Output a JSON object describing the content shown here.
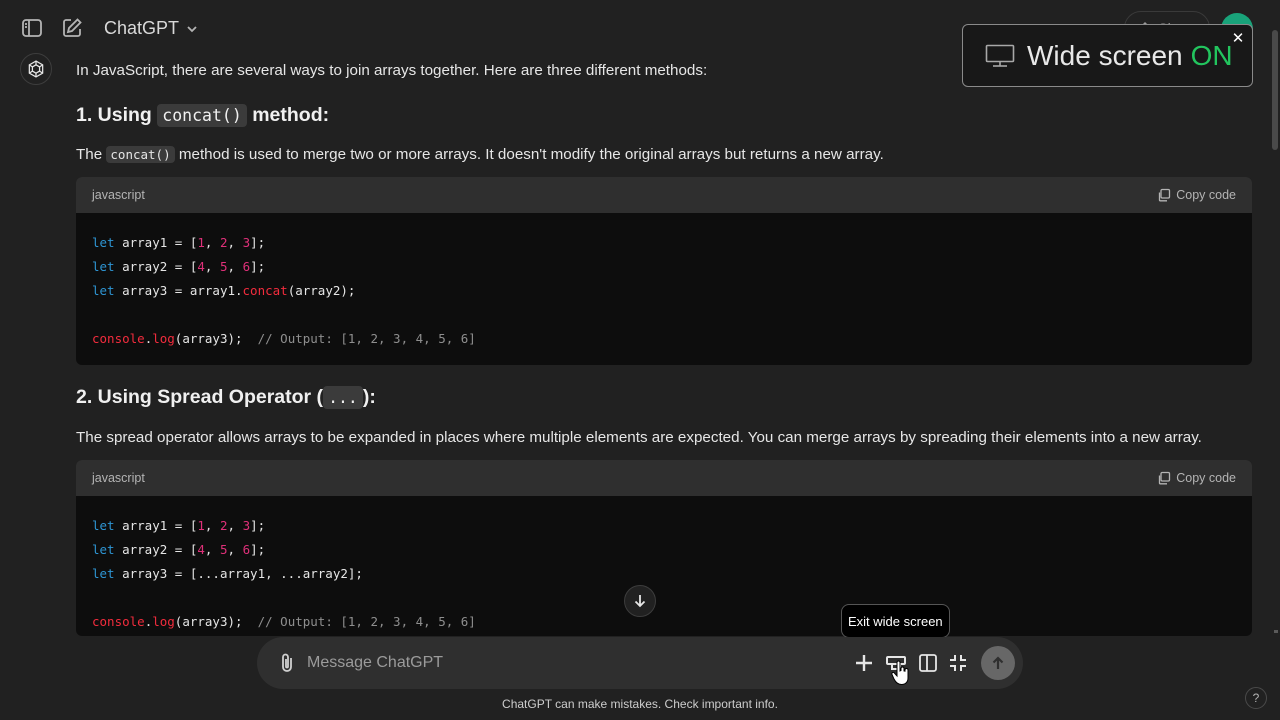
{
  "header": {
    "model_name": "ChatGPT",
    "share_label": "Share"
  },
  "toast": {
    "text": "Wide screen",
    "state": "ON",
    "state_color": "#22c55e"
  },
  "message": {
    "intro": "In JavaScript, there are several ways to join arrays together. Here are three different methods:",
    "section1": {
      "heading_prefix": "1. Using",
      "heading_code": "concat()",
      "heading_suffix": "method:",
      "desc_prefix": "The",
      "desc_code": "concat()",
      "desc_suffix": "method is used to merge two or more arrays. It doesn't modify the original arrays but returns a new array.",
      "code_lang": "javascript",
      "copy_label": "Copy code"
    },
    "section2": {
      "heading_prefix": "2. Using Spread Operator (",
      "heading_code": "...",
      "heading_suffix": "):",
      "desc": "The spread operator allows arrays to be expanded in places where multiple elements are expected. You can merge arrays by spreading their elements into a new array.",
      "code_lang": "javascript",
      "copy_label": "Copy code"
    },
    "code_common": {
      "kw_let": "let",
      "array1": "array1",
      "array2": "array2",
      "array3": "array3",
      "n1": "1",
      "n2": "2",
      "n3": "3",
      "n4": "4",
      "n5": "5",
      "n6": "6",
      "console": "console",
      "log": "log",
      "concat": "concat",
      "comment": "// Output: [1, 2, 3, 4, 5, 6]",
      "spread_expr": "[...array1, ...array2];"
    }
  },
  "composer": {
    "placeholder": "Message ChatGPT",
    "tooltip": "Exit wide screen"
  },
  "footer": {
    "disclaimer": "ChatGPT can make mistakes. Check important info.",
    "help": "?"
  },
  "icons": {
    "sidebar_toggle": "sidebar-icon",
    "new_chat": "edit-icon",
    "attach": "paperclip-icon",
    "add": "plus-icon",
    "exit_wide": "window-icon",
    "panel": "panel-icon",
    "collapse": "collapse-icon",
    "send": "arrow-up-icon"
  }
}
